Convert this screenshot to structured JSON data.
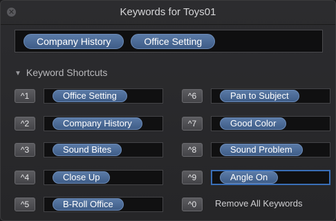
{
  "window": {
    "title": "Keywords for Toys01",
    "close_glyph": "✕"
  },
  "keyword_field": {
    "tokens": [
      "Company History",
      "Office Setting"
    ]
  },
  "shortcuts_section": {
    "label": "Keyword Shortcuts",
    "left": [
      {
        "key": "^1",
        "keyword": "Office Setting"
      },
      {
        "key": "^2",
        "keyword": "Company History"
      },
      {
        "key": "^3",
        "keyword": "Sound Bites"
      },
      {
        "key": "^4",
        "keyword": "Close Up"
      },
      {
        "key": "^5",
        "keyword": "B-Roll Office"
      }
    ],
    "right": [
      {
        "key": "^6",
        "keyword": "Pan to Subject"
      },
      {
        "key": "^7",
        "keyword": "Good Color"
      },
      {
        "key": "^8",
        "keyword": "Sound Problem"
      },
      {
        "key": "^9",
        "keyword": "Angle On"
      },
      {
        "key": "^0",
        "label": "Remove All Keywords"
      }
    ]
  },
  "colors": {
    "token_fill": "#4a6b98",
    "focus_ring": "#3a6fb8",
    "window_bg": "#2a2a2c"
  }
}
